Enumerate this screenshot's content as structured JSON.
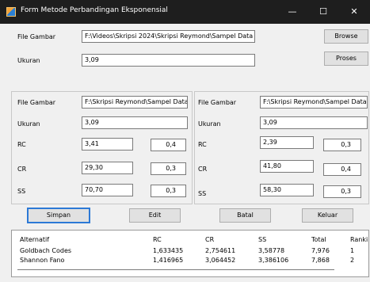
{
  "window": {
    "title": "Form Metode Perbandingan Eksponensial",
    "minimize": "—",
    "maximize": "☐",
    "close": "✕"
  },
  "top": {
    "file_label": "File Gambar",
    "file_value": "F:\\Videos\\Skripsi 2024\\Skripsi Reymond\\Sampel Data",
    "ukuran_label": "Ukuran",
    "ukuran_value": "3,09",
    "browse": "Browse",
    "proses": "Proses"
  },
  "left": {
    "file_label": "File Gambar",
    "file_value": "F:\\Skripsi Reymond\\Sampel Data",
    "ukuran_label": "Ukuran",
    "ukuran_value": "3,09",
    "rc_label": "RC",
    "rc_value": "3,41",
    "rc_weight": "0,4",
    "cr_label": "CR",
    "cr_value": "29,30",
    "cr_weight": "0,3",
    "ss_label": "SS",
    "ss_value": "70,70",
    "ss_weight": "0,3"
  },
  "right": {
    "file_label": "File Gambar",
    "file_value": "F:\\Skripsi Reymond\\Sampel Data",
    "ukuran_label": "Ukuran",
    "ukuran_value": "3,09",
    "rc_label": "RC",
    "rc_value": "2,39",
    "rc_weight": "0,3",
    "cr_label": "CR",
    "cr_value": "41,80",
    "cr_weight": "0,4",
    "ss_label": "SS",
    "ss_value": "58,30",
    "ss_weight": "0,3"
  },
  "buttons": {
    "simpan": "Simpan",
    "edit": "Edit",
    "batal": "Batal",
    "keluar": "Keluar"
  },
  "table": {
    "headers": [
      "Alternatif",
      "RC",
      "CR",
      "SS",
      "Total",
      "Ranking"
    ],
    "rows": [
      [
        "Goldbach Codes",
        "1,633435",
        "2,754611",
        "3,58778",
        "7,976",
        "1"
      ],
      [
        "Shannon Fano",
        "1,416965",
        "3,064452",
        "3,386106",
        "7,868",
        "2"
      ]
    ]
  }
}
